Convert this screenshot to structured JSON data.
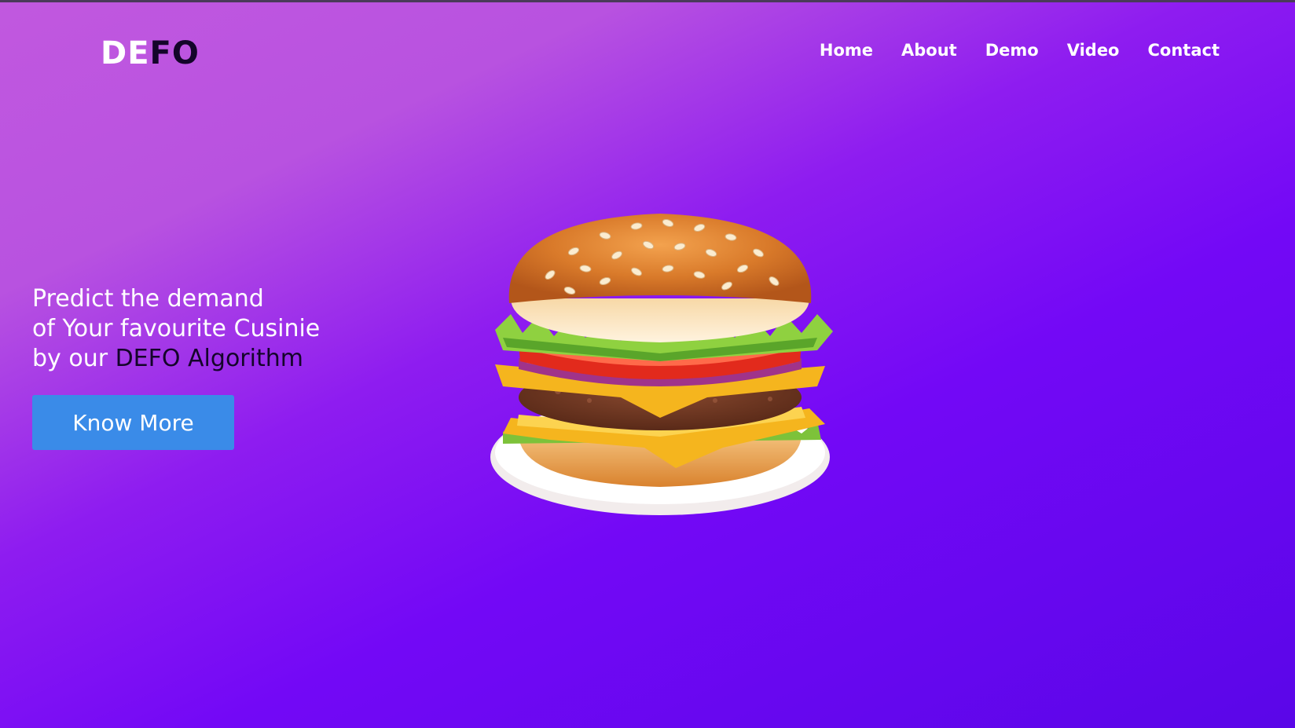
{
  "brand": {
    "logo_part1": "DE",
    "logo_part2": "FO"
  },
  "nav": {
    "items": [
      {
        "label": "Home"
      },
      {
        "label": "About"
      },
      {
        "label": "Demo"
      },
      {
        "label": "Video"
      },
      {
        "label": "Contact"
      }
    ]
  },
  "hero": {
    "line1": "Predict the demand",
    "line2": "of Your favourite Cusinie",
    "line3_prefix": "by our ",
    "line3_accent": "DEFO Algorithm",
    "button_label": "Know More"
  },
  "colors": {
    "button": "#3a8be8",
    "accent_text": "#14052a",
    "gradient_start": "#c158df",
    "gradient_end": "#5a06e8"
  },
  "icons": {
    "hero_image": "burger-illustration"
  }
}
